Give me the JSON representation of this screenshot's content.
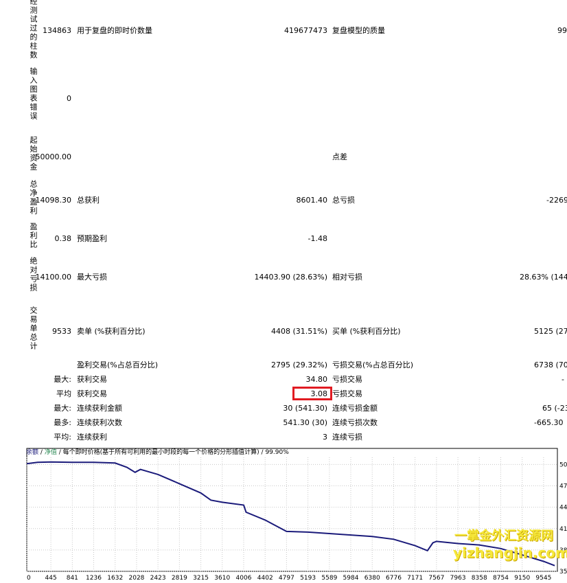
{
  "stats": {
    "bars_tested": {
      "label": "经测试过的柱数",
      "value": "134863"
    },
    "ticks": {
      "label": "用于复盘的即时价数量",
      "value": "419677473"
    },
    "quality": {
      "label": "复盘模型的质量",
      "value": "99"
    },
    "chart_errors": {
      "label": "输入图表错误",
      "value": "0"
    },
    "initial_deposit": {
      "label": "起始资金",
      "value": "50000.00"
    },
    "spread": {
      "label": "点差",
      "value": ""
    },
    "net_profit": {
      "label": "总净盈利",
      "value": "-14098.30"
    },
    "gross_profit": {
      "label": "总获利",
      "value": "8601.40"
    },
    "gross_loss": {
      "label": "总亏损",
      "value": "-2269"
    },
    "profit_factor": {
      "label": "盈利比",
      "value": "0.38"
    },
    "expected_payoff": {
      "label": "预期盈利",
      "value": "-1.48"
    },
    "abs_drawdown": {
      "label": "绝对亏损",
      "value": "14100.00"
    },
    "max_drawdown": {
      "label": "最大亏损",
      "value": "14403.90 (28.63%)"
    },
    "rel_drawdown": {
      "label": "相对亏损",
      "value": "28.63% (1440"
    },
    "total_trades": {
      "label": "交易单总计",
      "value": "9533"
    },
    "short_positions": {
      "label": "卖单 (%获利百分比)",
      "value": "4408 (31.51%)"
    },
    "long_positions": {
      "label": "买单 (%获利百分比)",
      "value": "5125 (27.4"
    },
    "profit_trades": {
      "label": "盈利交易(%占总百分比)",
      "value": "2795 (29.32%)"
    },
    "loss_trades": {
      "label": "亏损交易(%占总百分比)",
      "value": "6738 (70.6"
    },
    "largest_prefix": "最大:",
    "largest_profit": {
      "label": "获利交易",
      "value": "34.80"
    },
    "largest_loss": {
      "label": "亏损交易",
      "value": "-"
    },
    "average_prefix": "平均",
    "average_profit": {
      "label": "获利交易",
      "value": "3.08"
    },
    "average_loss": {
      "label": "亏损交易",
      "value": ""
    },
    "max_prefix": "最大:",
    "max_consec_wins": {
      "label": "连续获利金额",
      "value": "30 (541.30)"
    },
    "max_consec_losses": {
      "label": "连续亏损金额",
      "value": "65 (-23"
    },
    "most_prefix": "最多:",
    "max_consec_profit": {
      "label": "连续获利次数",
      "value": "541.30 (30)"
    },
    "max_consec_loss": {
      "label": "连续亏损次数",
      "value": "-665.30"
    },
    "avg_prefix": "平均:",
    "avg_consec_wins": {
      "label": "连续获利",
      "value": "3"
    },
    "avg_consec_losses": {
      "label": "连续亏损",
      "value": ""
    }
  },
  "chart_header": {
    "balance": "余额",
    "sep": "/",
    "equity": "净值",
    "desc": "每个即时价格(基于所有可利用的最小时段的每一个价格的分形插值计算)",
    "quality": "99.90%"
  },
  "watermark": {
    "line1": "一掌金外汇资源网",
    "line2": "yizhangjin.com"
  },
  "chart_data": {
    "type": "line",
    "title": "",
    "xlabel": "",
    "ylabel": "",
    "x_ticks": [
      "0",
      "445",
      "841",
      "1236",
      "1632",
      "2028",
      "2423",
      "2819",
      "3215",
      "3610",
      "4006",
      "4402",
      "4797",
      "5193",
      "5589",
      "5984",
      "6380",
      "6776",
      "7171",
      "7567",
      "7963",
      "8358",
      "8754",
      "9150",
      "9545"
    ],
    "y_ticks": [
      "50",
      "47",
      "44",
      "41",
      "38",
      "35"
    ],
    "ylim": [
      35,
      51
    ],
    "xlim": [
      0,
      9800
    ],
    "colors": {
      "balance": "#1a1a7a",
      "equity": "#2e8b57"
    },
    "series": [
      {
        "values": [
          [
            0,
            50.1
          ],
          [
            200,
            50.3
          ],
          [
            445,
            50.35
          ],
          [
            841,
            50.3
          ],
          [
            1236,
            50.3
          ],
          [
            1632,
            50.2
          ],
          [
            1850,
            49.6
          ],
          [
            2000,
            48.9
          ],
          [
            2100,
            49.3
          ],
          [
            2423,
            48.6
          ],
          [
            2819,
            47.3
          ],
          [
            3215,
            46.0
          ],
          [
            3400,
            45.0
          ],
          [
            3610,
            44.7
          ],
          [
            4006,
            44.3
          ],
          [
            4050,
            43.3
          ],
          [
            4402,
            42.2
          ],
          [
            4797,
            40.6
          ],
          [
            5193,
            40.5
          ],
          [
            5589,
            40.3
          ],
          [
            5984,
            40.1
          ],
          [
            6380,
            39.9
          ],
          [
            6776,
            39.5
          ],
          [
            7171,
            38.6
          ],
          [
            7400,
            37.9
          ],
          [
            7500,
            39.0
          ],
          [
            7567,
            39.2
          ],
          [
            7963,
            38.9
          ],
          [
            8358,
            38.7
          ],
          [
            8754,
            38.2
          ],
          [
            9150,
            37.3
          ],
          [
            9545,
            36.4
          ],
          [
            9750,
            35.8
          ]
        ]
      }
    ]
  }
}
